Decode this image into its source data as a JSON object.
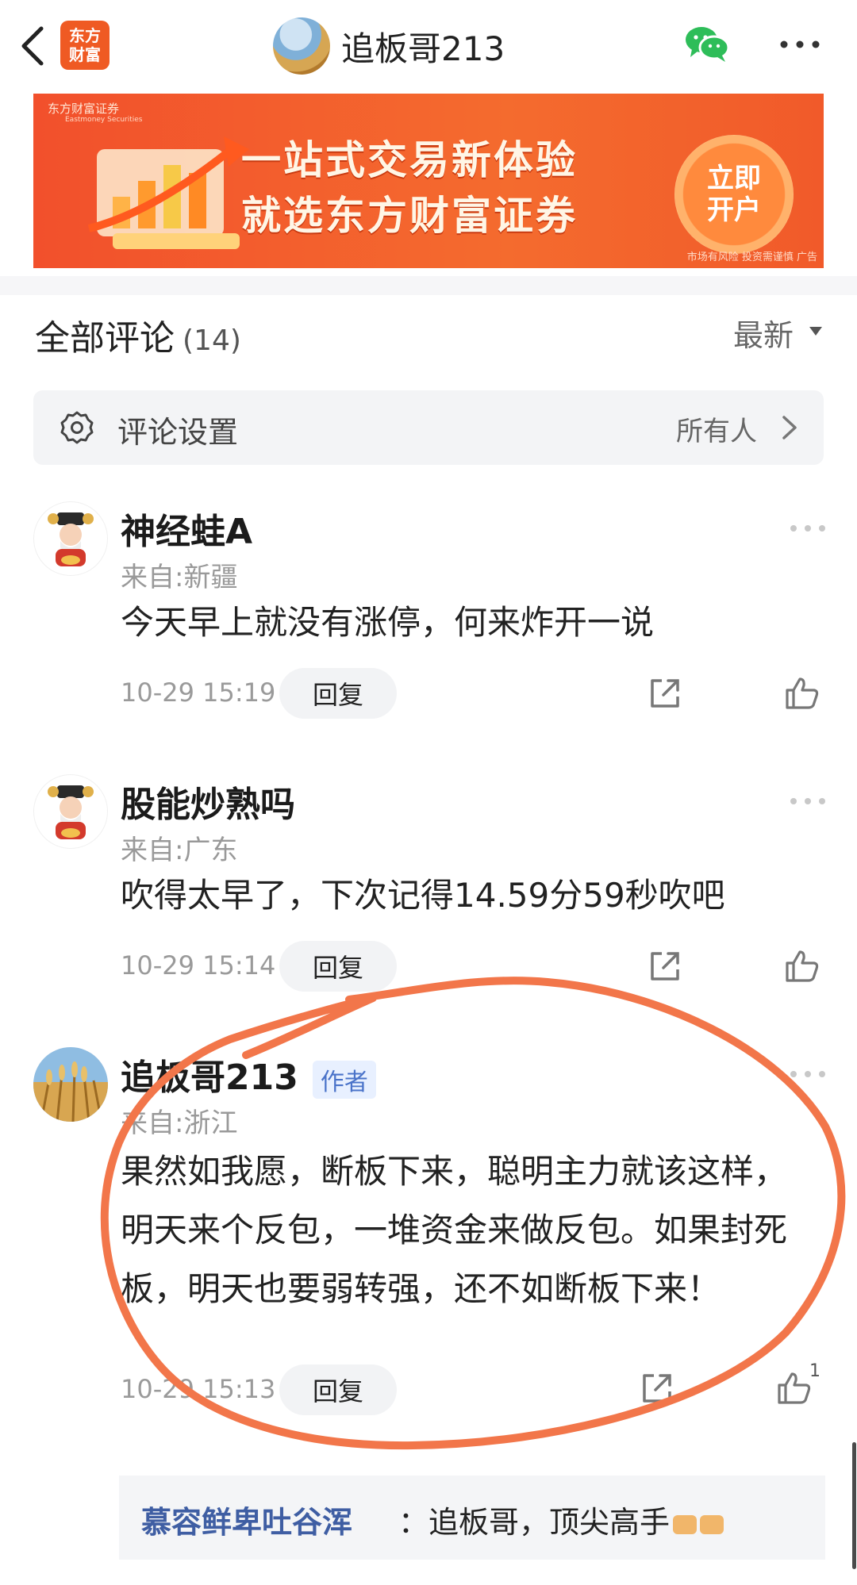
{
  "header": {
    "app_logo_text": [
      "东方",
      "财富"
    ],
    "title": "追板哥213",
    "icons": [
      "back-icon",
      "wechat-icon",
      "more-icon"
    ]
  },
  "banner": {
    "brand": "东方财富证券",
    "brand_sub": "Eastmoney Securities",
    "line1": "一站式交易新体验",
    "line2": "就选东方财富证券",
    "cta": [
      "立即",
      "开户"
    ],
    "risk": "市场有风险 投资需谨慎 广告"
  },
  "comments_section": {
    "title": "全部评论",
    "count": "(14)",
    "sort": "最新"
  },
  "settings": {
    "label": "评论设置",
    "value": "所有人"
  },
  "comments": [
    {
      "username": "神经蛙A",
      "location": "来自:新疆",
      "text": "今天早上就没有涨停，何来炸开一说",
      "time": "10-29 15:19",
      "reply": "回复"
    },
    {
      "username": "股能炒熟吗",
      "location": "来自:广东",
      "text": "吹得太早了，下次记得14.59分59秒吹吧",
      "time": "10-29 15:14",
      "reply": "回复"
    },
    {
      "username": "追板哥213",
      "badge": "作者",
      "location": "来自:浙江",
      "text": "果然如我愿，断板下来，聪明主力就该这样，明天来个反包，一堆资金来做反包。如果封死板，明天也要弱转强，还不如断板下来！",
      "time": "10-29 15:13",
      "reply": "回复",
      "likes": "1"
    }
  ],
  "sub_reply": {
    "name": "慕容鲜卑吐谷浑",
    "text": "：追板哥，顶尖高手"
  },
  "colors": {
    "accent_orange": "#f2502c",
    "annotation_circle": "#f2764a"
  }
}
